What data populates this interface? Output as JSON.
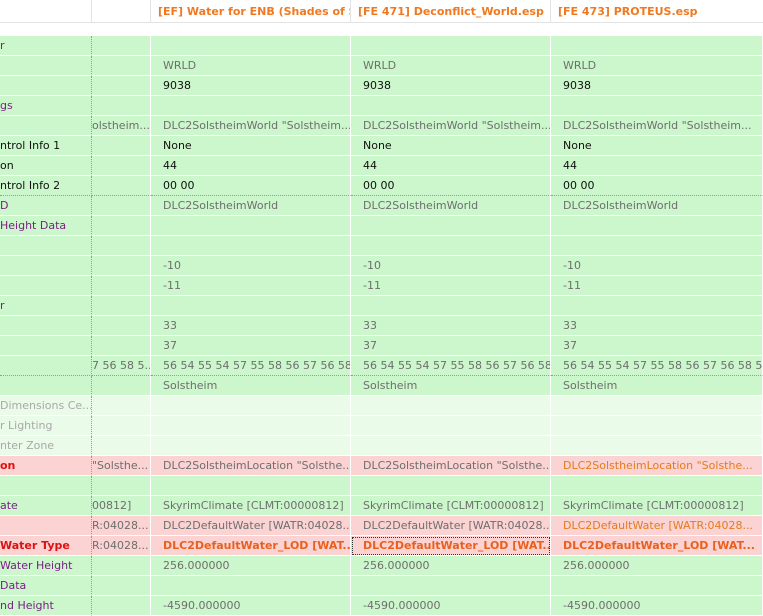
{
  "columns": [
    "",
    "",
    "[EF] Water for ENB (Shades of S...",
    "[FE 471] Deconflict_World.esp",
    "[FE 473] PROTEUS.esp"
  ],
  "rows": [
    {
      "label": "r",
      "label_style": "purple",
      "bg": "green",
      "dots": false,
      "values": [
        {
          "t": "",
          "c": "v-grey"
        },
        {
          "t": "",
          "c": "v-grey"
        },
        {
          "t": "",
          "c": "v-grey"
        },
        {
          "t": "",
          "c": "v-grey"
        }
      ]
    },
    {
      "label": "",
      "label_style": "black",
      "bg": "green",
      "dots": false,
      "values": [
        {
          "t": "",
          "c": "v-grey"
        },
        {
          "t": "WRLD",
          "c": "v-grey"
        },
        {
          "t": "WRLD",
          "c": "v-grey"
        },
        {
          "t": "WRLD",
          "c": "v-grey"
        }
      ]
    },
    {
      "label": "",
      "label_style": "black",
      "bg": "green",
      "dots": false,
      "values": [
        {
          "t": "",
          "c": "v-black"
        },
        {
          "t": "9038",
          "c": "v-black"
        },
        {
          "t": "9038",
          "c": "v-black"
        },
        {
          "t": "9038",
          "c": "v-black"
        }
      ]
    },
    {
      "label": "gs",
      "label_style": "purple",
      "bg": "green",
      "dots": false,
      "values": [
        {
          "t": "",
          "c": "v-grey"
        },
        {
          "t": "",
          "c": "v-grey"
        },
        {
          "t": "",
          "c": "v-grey"
        },
        {
          "t": "",
          "c": "v-grey"
        }
      ]
    },
    {
      "label": "",
      "label_style": "black",
      "bg": "green",
      "dots": false,
      "values": [
        {
          "t": "olstheim...",
          "c": "v-grey"
        },
        {
          "t": "DLC2SolstheimWorld \"Solstheim...",
          "c": "v-grey"
        },
        {
          "t": "DLC2SolstheimWorld \"Solstheim...",
          "c": "v-grey"
        },
        {
          "t": "DLC2SolstheimWorld \"Solstheim...",
          "c": "v-grey"
        }
      ]
    },
    {
      "label": "ntrol Info 1",
      "label_style": "black",
      "bg": "green",
      "dots": false,
      "values": [
        {
          "t": "",
          "c": "v-black"
        },
        {
          "t": "None",
          "c": "v-black"
        },
        {
          "t": "None",
          "c": "v-black"
        },
        {
          "t": "None",
          "c": "v-black"
        }
      ]
    },
    {
      "label": "on",
      "label_style": "black",
      "bg": "green",
      "dots": false,
      "values": [
        {
          "t": "",
          "c": "v-black"
        },
        {
          "t": "44",
          "c": "v-black"
        },
        {
          "t": "44",
          "c": "v-black"
        },
        {
          "t": "44",
          "c": "v-black"
        }
      ]
    },
    {
      "label": "ntrol Info 2",
      "label_style": "black",
      "bg": "green",
      "dots": true,
      "values": [
        {
          "t": "",
          "c": "v-black"
        },
        {
          "t": "00 00",
          "c": "v-black"
        },
        {
          "t": "00 00",
          "c": "v-black"
        },
        {
          "t": "00 00",
          "c": "v-black"
        }
      ]
    },
    {
      "label": "D",
      "label_style": "purple",
      "bg": "green",
      "dots": false,
      "values": [
        {
          "t": "",
          "c": "v-grey"
        },
        {
          "t": "DLC2SolstheimWorld",
          "c": "v-grey"
        },
        {
          "t": "DLC2SolstheimWorld",
          "c": "v-grey"
        },
        {
          "t": "DLC2SolstheimWorld",
          "c": "v-grey"
        }
      ]
    },
    {
      "label": "Height Data",
      "label_style": "purple",
      "bg": "green",
      "dots": false,
      "values": [
        {
          "t": "",
          "c": "v-grey"
        },
        {
          "t": "",
          "c": "v-grey"
        },
        {
          "t": "",
          "c": "v-grey"
        },
        {
          "t": "",
          "c": "v-grey"
        }
      ]
    },
    {
      "label": "",
      "label_style": "black",
      "bg": "green",
      "dots": false,
      "values": [
        {
          "t": "",
          "c": "v-grey"
        },
        {
          "t": "",
          "c": "v-grey"
        },
        {
          "t": "",
          "c": "v-grey"
        },
        {
          "t": "",
          "c": "v-grey"
        }
      ]
    },
    {
      "label": "",
      "label_style": "black",
      "bg": "green",
      "dots": false,
      "values": [
        {
          "t": "",
          "c": "v-grey"
        },
        {
          "t": "-10",
          "c": "v-grey"
        },
        {
          "t": "-10",
          "c": "v-grey"
        },
        {
          "t": "-10",
          "c": "v-grey"
        }
      ]
    },
    {
      "label": "",
      "label_style": "black",
      "bg": "green",
      "dots": false,
      "values": [
        {
          "t": "",
          "c": "v-grey"
        },
        {
          "t": "-11",
          "c": "v-grey"
        },
        {
          "t": "-11",
          "c": "v-grey"
        },
        {
          "t": "-11",
          "c": "v-grey"
        }
      ]
    },
    {
      "label": "r",
      "label_style": "purple",
      "bg": "green",
      "dots": false,
      "values": [
        {
          "t": "",
          "c": "v-grey"
        },
        {
          "t": "",
          "c": "v-grey"
        },
        {
          "t": "",
          "c": "v-grey"
        },
        {
          "t": "",
          "c": "v-grey"
        }
      ]
    },
    {
      "label": "",
      "label_style": "black",
      "bg": "green",
      "dots": false,
      "values": [
        {
          "t": "",
          "c": "v-grey"
        },
        {
          "t": "33",
          "c": "v-grey"
        },
        {
          "t": "33",
          "c": "v-grey"
        },
        {
          "t": "33",
          "c": "v-grey"
        }
      ]
    },
    {
      "label": "",
      "label_style": "black",
      "bg": "green",
      "dots": false,
      "values": [
        {
          "t": "",
          "c": "v-grey"
        },
        {
          "t": "37",
          "c": "v-grey"
        },
        {
          "t": "37",
          "c": "v-grey"
        },
        {
          "t": "37",
          "c": "v-grey"
        }
      ]
    },
    {
      "label": "",
      "label_style": "black",
      "bg": "green",
      "dots": true,
      "values": [
        {
          "t": "7 56 58 5...",
          "c": "v-grey"
        },
        {
          "t": "56 54 55 54 57 55 58 56 57 56 58 5...",
          "c": "v-grey"
        },
        {
          "t": "56 54 55 54 57 55 58 56 57 56 58 5...",
          "c": "v-grey"
        },
        {
          "t": "56 54 55 54 57 55 58 56 57 56 58 5...",
          "c": "v-grey"
        }
      ]
    },
    {
      "label": "",
      "label_style": "black",
      "bg": "green",
      "dots": false,
      "values": [
        {
          "t": "",
          "c": "v-grey"
        },
        {
          "t": "Solstheim",
          "c": "v-grey"
        },
        {
          "t": "Solstheim",
          "c": "v-grey"
        },
        {
          "t": "Solstheim",
          "c": "v-grey"
        }
      ]
    },
    {
      "label": "Dimensions Ce...",
      "label_style": "grey",
      "bg": "pale",
      "dots": false,
      "values": [
        {
          "t": "",
          "c": "v-grey"
        },
        {
          "t": "",
          "c": "v-grey"
        },
        {
          "t": "",
          "c": "v-grey"
        },
        {
          "t": "",
          "c": "v-grey"
        }
      ]
    },
    {
      "label": "r Lighting",
      "label_style": "grey",
      "bg": "pale",
      "dots": false,
      "values": [
        {
          "t": "",
          "c": "v-grey"
        },
        {
          "t": "",
          "c": "v-grey"
        },
        {
          "t": "",
          "c": "v-grey"
        },
        {
          "t": "",
          "c": "v-grey"
        }
      ]
    },
    {
      "label": "nter Zone",
      "label_style": "grey",
      "bg": "pale",
      "dots": false,
      "values": [
        {
          "t": "",
          "c": "v-grey"
        },
        {
          "t": "",
          "c": "v-grey"
        },
        {
          "t": "",
          "c": "v-grey"
        },
        {
          "t": "",
          "c": "v-grey"
        }
      ]
    },
    {
      "label": "on",
      "label_style": "red",
      "bg": "pink",
      "dots": false,
      "values": [
        {
          "t": "\"Solsthe...",
          "c": "v-grey"
        },
        {
          "t": "DLC2SolstheimLocation \"Solsthe...",
          "c": "v-grey"
        },
        {
          "t": "DLC2SolstheimLocation \"Solsthe...",
          "c": "v-grey"
        },
        {
          "t": "DLC2SolstheimLocation \"Solsthe...",
          "c": "v-orange"
        }
      ]
    },
    {
      "label": "",
      "label_style": "black",
      "bg": "green",
      "dots": false,
      "values": [
        {
          "t": "",
          "c": "v-grey"
        },
        {
          "t": "",
          "c": "v-grey"
        },
        {
          "t": "",
          "c": "v-grey"
        },
        {
          "t": "",
          "c": "v-grey"
        }
      ]
    },
    {
      "label": "ate",
      "label_style": "purple",
      "bg": "green",
      "dots": false,
      "values": [
        {
          "t": "00812]",
          "c": "v-grey"
        },
        {
          "t": "SkyrimClimate [CLMT:00000812]",
          "c": "v-grey"
        },
        {
          "t": "SkyrimClimate [CLMT:00000812]",
          "c": "v-grey"
        },
        {
          "t": "SkyrimClimate [CLMT:00000812]",
          "c": "v-grey"
        }
      ]
    },
    {
      "label": "",
      "label_style": "black",
      "bg": "pink",
      "dots": false,
      "values": [
        {
          "t": "R:04028...",
          "c": "v-grey"
        },
        {
          "t": "DLC2DefaultWater [WATR:04028...",
          "c": "v-grey"
        },
        {
          "t": "DLC2DefaultWater [WATR:04028...",
          "c": "v-grey"
        },
        {
          "t": "DLC2DefaultWater [WATR:04028...",
          "c": "v-orange"
        }
      ]
    },
    {
      "label": "Water Type",
      "label_style": "red",
      "bg": "pink",
      "dots": false,
      "values": [
        {
          "t": "R:04028...",
          "c": "v-grey"
        },
        {
          "t": "DLC2DefaultWater_LOD [WAT...",
          "c": "v-bold-orange"
        },
        {
          "t": "DLC2DefaultWater_LOD [WAT...",
          "c": "v-bold-orange"
        },
        {
          "t": "DLC2DefaultWater_LOD [WAT...",
          "c": "v-bold-orange"
        }
      ]
    },
    {
      "label": "Water Height",
      "label_style": "purple",
      "bg": "green",
      "dots": false,
      "values": [
        {
          "t": "",
          "c": "v-grey"
        },
        {
          "t": "256.000000",
          "c": "v-grey"
        },
        {
          "t": "256.000000",
          "c": "v-grey"
        },
        {
          "t": "256.000000",
          "c": "v-grey"
        }
      ]
    },
    {
      "label": "Data",
      "label_style": "purple",
      "bg": "green",
      "dots": false,
      "values": [
        {
          "t": "",
          "c": "v-grey"
        },
        {
          "t": "",
          "c": "v-grey"
        },
        {
          "t": "",
          "c": "v-grey"
        },
        {
          "t": "",
          "c": "v-grey"
        }
      ]
    },
    {
      "label": "nd Height",
      "label_style": "purple",
      "bg": "green",
      "dots": false,
      "values": [
        {
          "t": "",
          "c": "v-grey"
        },
        {
          "t": "-4590.000000",
          "c": "v-grey"
        },
        {
          "t": "-4590.000000",
          "c": "v-grey"
        },
        {
          "t": "-4590.000000",
          "c": "v-grey"
        }
      ]
    }
  ],
  "focused_cell": {
    "row": 25,
    "col": 3
  }
}
